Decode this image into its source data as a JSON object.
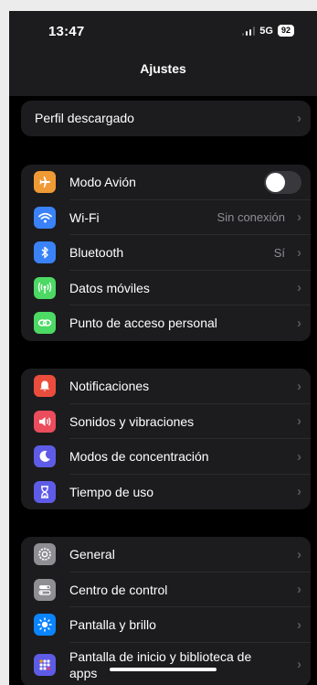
{
  "status": {
    "time": "13:47",
    "network": "5G",
    "battery": "92"
  },
  "nav": {
    "title": "Ajustes"
  },
  "profile_group": [
    {
      "label": "Perfil descargado"
    }
  ],
  "connectivity_group": [
    {
      "label": "Modo Avión",
      "icon": "airplane-icon",
      "color": "#f09a36",
      "toggle": false
    },
    {
      "label": "Wi-Fi",
      "icon": "wifi-icon",
      "color": "#3a82f7",
      "value": "Sin conexión"
    },
    {
      "label": "Bluetooth",
      "icon": "bluetooth-icon",
      "color": "#3a82f7",
      "value": "Sí"
    },
    {
      "label": "Datos móviles",
      "icon": "antenna-icon",
      "color": "#4cd964"
    },
    {
      "label": "Punto de acceso personal",
      "icon": "hotspot-icon",
      "color": "#4cd964"
    }
  ],
  "notifications_group": [
    {
      "label": "Notificaciones",
      "icon": "bell-icon",
      "color": "#eb4d3d"
    },
    {
      "label": "Sonidos y vibraciones",
      "icon": "speaker-icon",
      "color": "#eb4d5d"
    },
    {
      "label": "Modos de concentración",
      "icon": "moon-icon",
      "color": "#5e5ce6"
    },
    {
      "label": "Tiempo de uso",
      "icon": "hourglass-icon",
      "color": "#5e5ce6"
    }
  ],
  "general_group": [
    {
      "label": "General",
      "icon": "gear-icon",
      "color": "#8e8e93"
    },
    {
      "label": "Centro de control",
      "icon": "switches-icon",
      "color": "#8e8e93"
    },
    {
      "label": "Pantalla y brillo",
      "icon": "sun-icon",
      "color": "#0a84ff"
    },
    {
      "label": "Pantalla de inicio y biblioteca de apps",
      "icon": "apps-grid-icon",
      "color": "#5e5ce6"
    }
  ]
}
